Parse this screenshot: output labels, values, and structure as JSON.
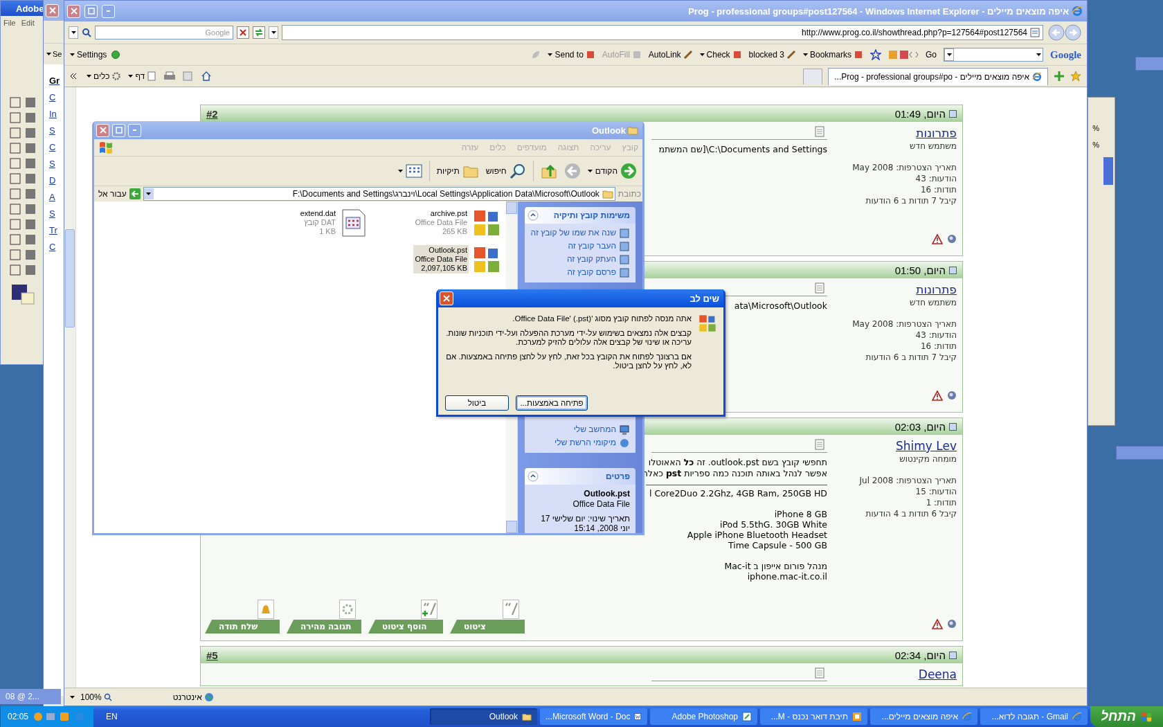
{
  "photoshop": {
    "title": "Adobe",
    "menu": [
      "Edit",
      "File"
    ],
    "minimized_document": "08 @ 2...",
    "panel_readings": [
      "%",
      "%"
    ]
  },
  "back_window": {
    "toolbar_item": "Se",
    "sidebar_letters": [
      "Gr",
      "C",
      "In",
      "S",
      "C",
      "S",
      "D",
      "A",
      "S",
      "Tr",
      "C"
    ]
  },
  "browser": {
    "title": "איפה מוצאים מיילים - Prog - professional groups#post127564 - Windows Internet Explorer",
    "search_placeholder": "Google",
    "address": "http://www.prog.co.il/showthread.php?p=127564#post127564",
    "settings": "Settings",
    "google_toolbar": [
      {
        "label": "Bookmarks",
        "kind": "menu"
      },
      {
        "label": "blocked 3",
        "kind": "plain"
      },
      {
        "label": "Check",
        "kind": "menu"
      },
      {
        "label": "AutoLink",
        "kind": "plain"
      },
      {
        "label": "AutoFill",
        "kind": "disabled"
      },
      {
        "label": "Send to",
        "kind": "menu"
      }
    ],
    "go": "Go",
    "logo": "Google",
    "command_bar": [
      "דף",
      "כלים"
    ],
    "tab": "איפה מוצאים מיילים - Prog - professional groups#po...",
    "status": {
      "zoom": "100%",
      "zone": "אינטרנט"
    }
  },
  "posts": [
    {
      "number": "#2",
      "date": "היום, 01:49",
      "user": "פתרונות",
      "role": "משתמש חדש",
      "info": [
        "תאריך הצטרפות: May 2008",
        "הודעות: 43",
        "תודות: 16",
        "קיבל 7 תודות ב 6 הודעות"
      ],
      "body": [
        "C:\\Documents and Settings\\[שם המשתמ"
      ]
    },
    {
      "date": "היום, 01:50",
      "user": "פתרונות",
      "role": "משתמש חדש",
      "info": [
        "תאריך הצטרפות: May 2008",
        "הודעות: 43",
        "תודות: 16",
        "קיבל 7 תודות ב 6 הודעות"
      ],
      "body": [
        "ata\\Microsoft\\Outlook"
      ]
    },
    {
      "date": "היום, 02:03",
      "user": "Shimy Lev",
      "role": "מומחה מקינטוש",
      "info": [
        "תאריך הצטרפות: Jul 2008",
        "הודעות: 15",
        "תודות: 1",
        "קיבל 6 תודות ב 4 הודעות"
      ],
      "body": [
        "תחפשי קובץ בשם outlook.pst. זה **כל** האאוטלו",
        "אפשר לנהל באותה תוכנה כמה ספריות **pst** כאלה"
      ],
      "signature": [
        [
          "l Core2Duo 2.2Ghz, 4GB Ram, 250GB HD"
        ],
        [
          "iPhone 8 GB",
          "iPod 5.5thG. 30GB White",
          "Apple iPhone Bluetooth Headset",
          "Time Capsule - 500 GB"
        ],
        [
          "מנהל פורום אייפון ב Mac-it",
          "iphone.mac-it.co.il"
        ]
      ],
      "buttons": [
        "ציטוט",
        "הוסף ציטוט",
        "תגובה מהירה",
        "שלח תודה"
      ]
    },
    {
      "number": "#5",
      "date": "היום, 02:34",
      "user": "Deena"
    }
  ],
  "explorer": {
    "title": "Outlook",
    "menu": [
      "קובץ",
      "עריכה",
      "תצוגה",
      "מועדפים",
      "כלים",
      "עזרה"
    ],
    "back": "הקודם",
    "search": "חיפוש",
    "folders": "תיקיות",
    "address_label": "כתובת",
    "path": "F:\\Documents and Settings\\וינברג\\Local Settings\\Application Data\\Microsoft\\Outlook",
    "go": "עבור אל",
    "files": [
      {
        "name": "archive.pst",
        "type": "Office Data File",
        "size": "265 KB",
        "kind": "office",
        "selected": false
      },
      {
        "name": "Outlook.pst",
        "type": "Office Data File",
        "size": "2,097,105 KB",
        "kind": "office",
        "selected": true
      },
      {
        "name": "extend.dat",
        "type": "קובץ DAT",
        "size": "1 KB",
        "kind": "dat",
        "selected": false
      }
    ],
    "tasks_title": "משימות קובץ ותיקיה",
    "tasks": [
      "שנה את שמו של קובץ זה",
      "העבר קובץ זה",
      "העתק קובץ זה",
      "פרסם קובץ זה"
    ],
    "places": [
      "המחשב שלי",
      "מיקומי הרשת שלי"
    ],
    "details_title": "פרטים",
    "details": {
      "name": "Outlook.pst",
      "type": "Office Data File",
      "modified": "תאריך שינוי: יום שלישי 17 יוני 2008, 15:14"
    }
  },
  "dialog": {
    "title": "שים לב",
    "paragraphs": [
      "אתה מנסה לפתוח קובץ מסוג 'Office Data File' (.pst).",
      "קבצים אלה נמצאים בשימוש על-ידי מערכת ההפעלה ועל-ידי תוכניות שונות. עריכה או שינוי של קבצים אלה עלולים להזיק למערכת.",
      "אם ברצונך לפתוח את הקובץ בכל זאת, לחץ על לחצן פתיחה באמצעות. אם לא, לחץ על לחצן ביטול."
    ],
    "buttons": [
      "פתיחה באמצעות...",
      "ביטול"
    ]
  },
  "taskbar": {
    "start": "התחל",
    "tasks": [
      {
        "label": "Gmail - תגובה לדוא...",
        "kind": "ie",
        "selected": false
      },
      {
        "label": "איפה מוצאים מיילים...",
        "kind": "ie",
        "selected": false
      },
      {
        "label": "תיבת דואר נכנס - M...",
        "kind": "mail",
        "selected": false
      },
      {
        "label": "Adobe Photoshop",
        "kind": "ps",
        "selected": false
      },
      {
        "label": "Microsoft Word - Doc...",
        "kind": "word",
        "selected": false
      },
      {
        "label": "Outlook",
        "kind": "folder",
        "selected": true
      }
    ],
    "language": "EN",
    "clock": "02:05"
  }
}
